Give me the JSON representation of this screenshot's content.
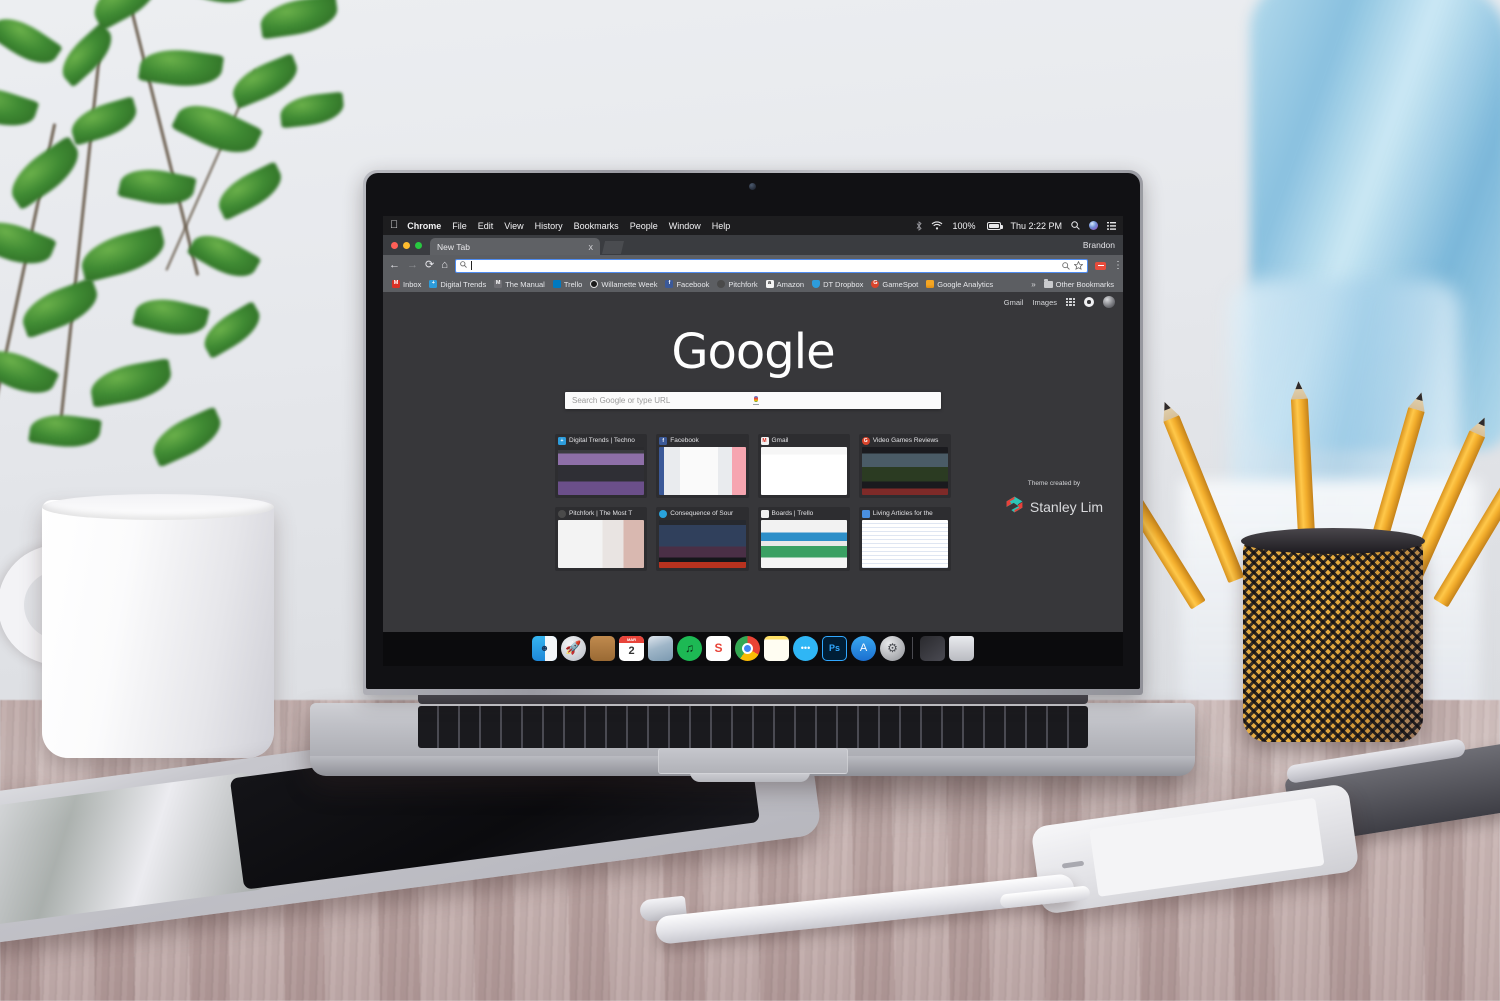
{
  "scene": {
    "description": "MacBook Pro on a rustic wooden desk with plant, coffee mug, pencil cup, tablet, phone and pen"
  },
  "macos_menubar": {
    "apple_logo": "",
    "menus": [
      "Chrome",
      "File",
      "Edit",
      "View",
      "History",
      "Bookmarks",
      "People",
      "Window",
      "Help"
    ],
    "active_app": "Chrome",
    "status": {
      "bluetooth_icon": "bluetooth-icon",
      "wifi_icon": "wifi-icon",
      "battery_percent": "100%",
      "battery_icon": "battery-icon",
      "clock": "Thu 2:22 PM",
      "spotlight_icon": "search-icon",
      "siri_icon": "siri-icon",
      "notification_center_icon": "list-icon"
    }
  },
  "browser": {
    "window_controls": [
      "close",
      "minimize",
      "maximize"
    ],
    "tabs": [
      {
        "title": "New Tab",
        "close_label": "x",
        "active": true
      }
    ],
    "new_tab_button_label": "+",
    "profile_name": "Brandon",
    "toolbar": {
      "back_label": "←",
      "forward_label": "→",
      "reload_label": "⟳",
      "home_label": "⌂",
      "omnibox_value": "",
      "omnibox_placeholder": "",
      "omnibox_search_icon": "search-icon",
      "zoom_icon": "magnifier-icon",
      "bookmark_star_icon": "star-icon",
      "extension_icon": "extension-icon",
      "menu_icon": "kebab-menu-icon"
    },
    "bookmarks": [
      {
        "label": "Inbox",
        "icon": "gmail-icon",
        "glyph": "M",
        "color": "#d93025"
      },
      {
        "label": "Digital Trends",
        "icon": "dt-icon",
        "glyph": "+",
        "color": "#2d9cdb"
      },
      {
        "label": "The Manual",
        "icon": "manual-icon",
        "glyph": "M",
        "color": "#6e6e73"
      },
      {
        "label": "Trello",
        "icon": "trello-icon",
        "glyph": "",
        "color": "#0079bf"
      },
      {
        "label": "Willamette Week",
        "icon": "ww-icon",
        "glyph": "",
        "color": "#1a1a1a"
      },
      {
        "label": "Facebook",
        "icon": "facebook-icon",
        "glyph": "f",
        "color": "#3b5998"
      },
      {
        "label": "Pitchfork",
        "icon": "pitchfork-icon",
        "glyph": "",
        "color": "#4a4a4a"
      },
      {
        "label": "Amazon",
        "icon": "amazon-icon",
        "glyph": "a",
        "color": "#f3f3f3"
      },
      {
        "label": "DT Dropbox",
        "icon": "dropbox-icon",
        "glyph": "",
        "color": "#2d9cdb"
      },
      {
        "label": "GameSpot",
        "icon": "gamespot-icon",
        "glyph": "G",
        "color": "#d9442b"
      },
      {
        "label": "Google Analytics",
        "icon": "analytics-icon",
        "glyph": "",
        "color": "#f5a623"
      }
    ],
    "bookmarks_overflow_label": "»",
    "other_bookmarks_label": "Other Bookmarks"
  },
  "newtab": {
    "logo_text": "Google",
    "top_links": [
      {
        "label": "Gmail"
      },
      {
        "label": "Images"
      }
    ],
    "apps_grid_icon": "apps-grid-icon",
    "notification_icon": "notification-dot-icon",
    "avatar_icon": "avatar-icon",
    "searchbox_placeholder": "Search Google or type URL",
    "mic_icon": "microphone-icon",
    "tiles": [
      {
        "title": "Digital Trends | Techno",
        "icon_glyph": "+",
        "icon_color": "#2d9cdb",
        "shot": "dark-tech-site"
      },
      {
        "title": "Facebook",
        "icon_glyph": "f",
        "icon_color": "#3b5998",
        "shot": "facebook-feed"
      },
      {
        "title": "Gmail",
        "icon_glyph": "M",
        "icon_color": "#f1f1f1",
        "shot": "gmail-inbox"
      },
      {
        "title": "Video Games Reviews",
        "icon_glyph": "G",
        "icon_color": "#d9442b",
        "shot": "gamespot-home"
      },
      {
        "title": "Pitchfork | The Most T",
        "icon_glyph": "",
        "icon_color": "#4a4a4a",
        "shot": "pitchfork-home"
      },
      {
        "title": "Consequence of Sour",
        "icon_glyph": "",
        "icon_color": "#29a3dc",
        "shot": "concert-photo"
      },
      {
        "title": "Boards | Trello",
        "icon_glyph": "",
        "icon_color": "#f1f1f1",
        "shot": "trello-boards"
      },
      {
        "title": "Living Articles for the",
        "icon_glyph": "",
        "icon_color": "#4a90e2",
        "shot": "text-document"
      }
    ],
    "credit": {
      "label": "Theme created by",
      "name": "Stanley Lim",
      "logo_icon": "stanley-lim-logo",
      "logo_colors": [
        "#2ec4b6",
        "#e8413a"
      ]
    }
  },
  "dock": {
    "items": [
      {
        "name": "Finder",
        "glyph": "",
        "running": true
      },
      {
        "name": "Launchpad",
        "glyph": "",
        "running": false
      },
      {
        "name": "Contacts",
        "glyph": "",
        "running": false
      },
      {
        "name": "Calendar",
        "glyph": "2",
        "month": "MAR",
        "running": false
      },
      {
        "name": "Photos",
        "glyph": "",
        "running": false
      },
      {
        "name": "Spotify",
        "glyph": "",
        "running": true
      },
      {
        "name": "Evernote Skitch",
        "glyph": "S",
        "running": false
      },
      {
        "name": "Google Chrome",
        "glyph": "",
        "running": true
      },
      {
        "name": "Notes",
        "glyph": "",
        "running": false
      },
      {
        "name": "Messages",
        "glyph": "",
        "running": false
      },
      {
        "name": "Adobe Photoshop",
        "glyph": "Ps",
        "running": false
      },
      {
        "name": "App Store",
        "glyph": "A",
        "running": false
      },
      {
        "name": "System Preferences",
        "glyph": "",
        "running": false
      },
      {
        "name": "Recent Item",
        "glyph": "",
        "running": true
      },
      {
        "name": "Trash",
        "glyph": "",
        "running": false
      }
    ]
  }
}
